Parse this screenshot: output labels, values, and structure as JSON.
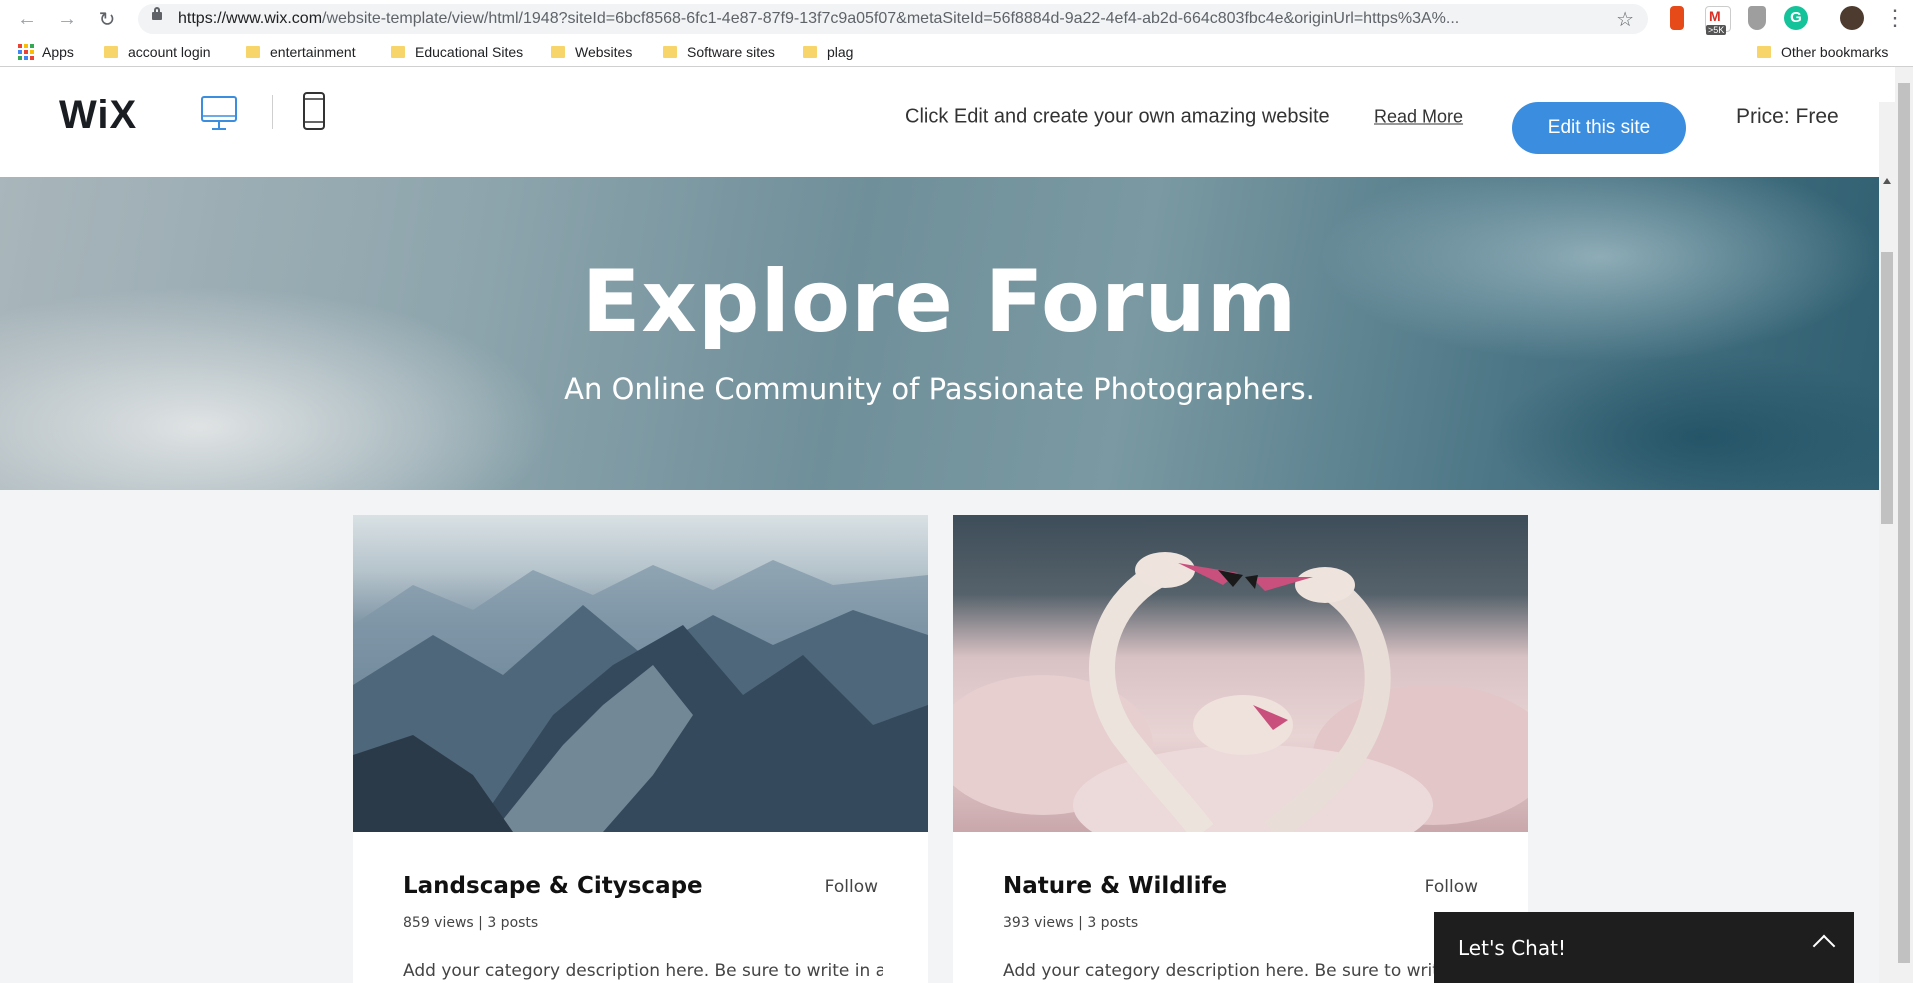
{
  "browser": {
    "url_host": "https://www.wix.com",
    "url_path": "/website-template/view/html/1948?siteId=6bcf8568-6fc1-4e87-87f9-13f7c9a05f07&metaSiteId=56f8884d-9a22-4ef4-ab2d-664c803fbc4e&originUrl=https%3A%...",
    "gmail_badge": ">5K",
    "grammarly_letter": "G",
    "bookmarks": [
      "Apps",
      "account login",
      "entertainment",
      "Educational Sites",
      "Websites",
      "Software sites",
      "plag"
    ],
    "other_bookmarks": "Other bookmarks"
  },
  "wix_bar": {
    "logo": "WiX",
    "tagline": "Click Edit and create your own amazing website",
    "read_more": "Read More",
    "edit_button": "Edit this site",
    "price": "Price: Free",
    "accent_color": "#3b8de0"
  },
  "hero": {
    "title": "Explore Forum",
    "subtitle": "An Online Community of Passionate Photographers."
  },
  "categories": [
    {
      "title": "Landscape & Cityscape",
      "follow": "Follow",
      "stats": "859 views | 3 posts",
      "description": "Add your category description here. Be sure to write in an"
    },
    {
      "title": "Nature & Wildlife",
      "follow": "Follow",
      "stats": "393 views | 3 posts",
      "description": "Add your category description here. Be sure to write in"
    }
  ],
  "chat": {
    "label": "Let's Chat!"
  }
}
